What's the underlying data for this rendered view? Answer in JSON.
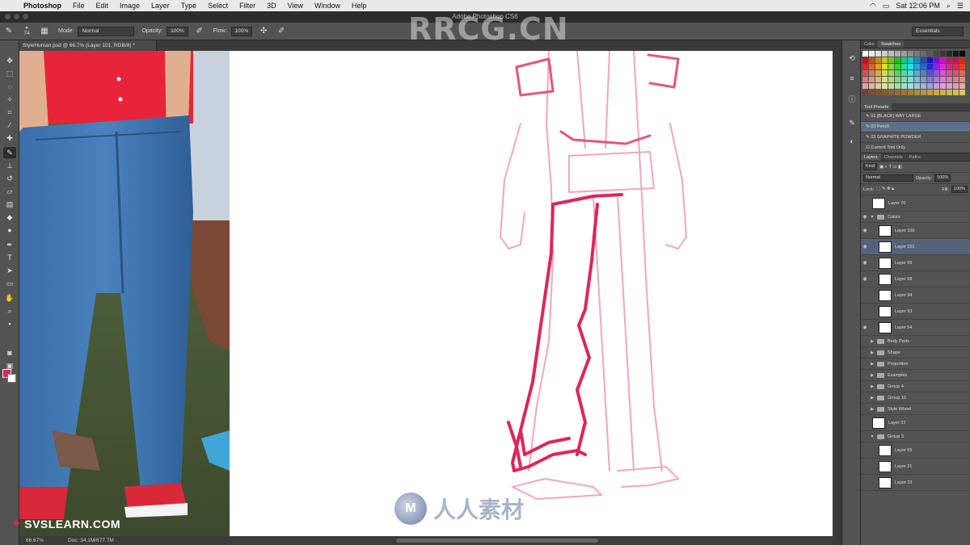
{
  "menubar": {
    "app": "Photoshop",
    "items": [
      "File",
      "Edit",
      "Image",
      "Layer",
      "Type",
      "Select",
      "Filter",
      "3D",
      "View",
      "Window",
      "Help"
    ],
    "clock": "Sat 12:06 PM"
  },
  "title": "Adobe Photoshop CS6",
  "options": {
    "brush_size": "74",
    "mode_label": "Mode:",
    "mode_value": "Normal",
    "opacity_label": "Opacity:",
    "opacity_value": "100%",
    "flow_label": "Flow:",
    "flow_value": "100%",
    "workspace": "Essentials"
  },
  "document": {
    "tab": "StyleHuman.psd @ 66.7% (Layer 101, RGB/8) *",
    "zoom": "66.67%",
    "doc_info": "Doc: 34.1M/677.7M"
  },
  "colors": {
    "foreground": "#e0245a",
    "background": "#ffffff",
    "sketch": "#e0245a"
  },
  "color_panel": {
    "tabs": [
      "Color",
      "Swatches"
    ]
  },
  "tool_presets": {
    "title": "Tool Presets",
    "items": [
      "01 [BLACK] WAY LARGE",
      "03 Pencil",
      "03 GRAPHITE POWDER"
    ],
    "current_only": "Current Tool Only"
  },
  "layers_panel": {
    "tabs": [
      "Layers",
      "Channels",
      "Paths"
    ],
    "kind": "Kind",
    "blend": "Normal",
    "opacity_label": "Opacity:",
    "opacity_value": "100%",
    "lock_label": "Lock:",
    "fill_label": "Fill:",
    "fill_value": "100%",
    "layers": [
      "Layer 70",
      "Colors",
      "Layer 100",
      "Layer 101",
      "Layer 99",
      "Layer 98",
      "Layer 94",
      "Layer 93",
      "Layer 54"
    ],
    "groups": [
      "Body Parts",
      "Shape",
      "Proportion",
      "Examples",
      "Group 4",
      "Group 10",
      "Style Wheel"
    ],
    "more_layers": [
      "Layer 22",
      "Group 3",
      "Layer 69",
      "Layer 21",
      "Layer 23"
    ]
  },
  "watermarks": {
    "top": "RRCG.CN",
    "bottom": "人人素材",
    "svs": "SVSLEARN.COM"
  }
}
